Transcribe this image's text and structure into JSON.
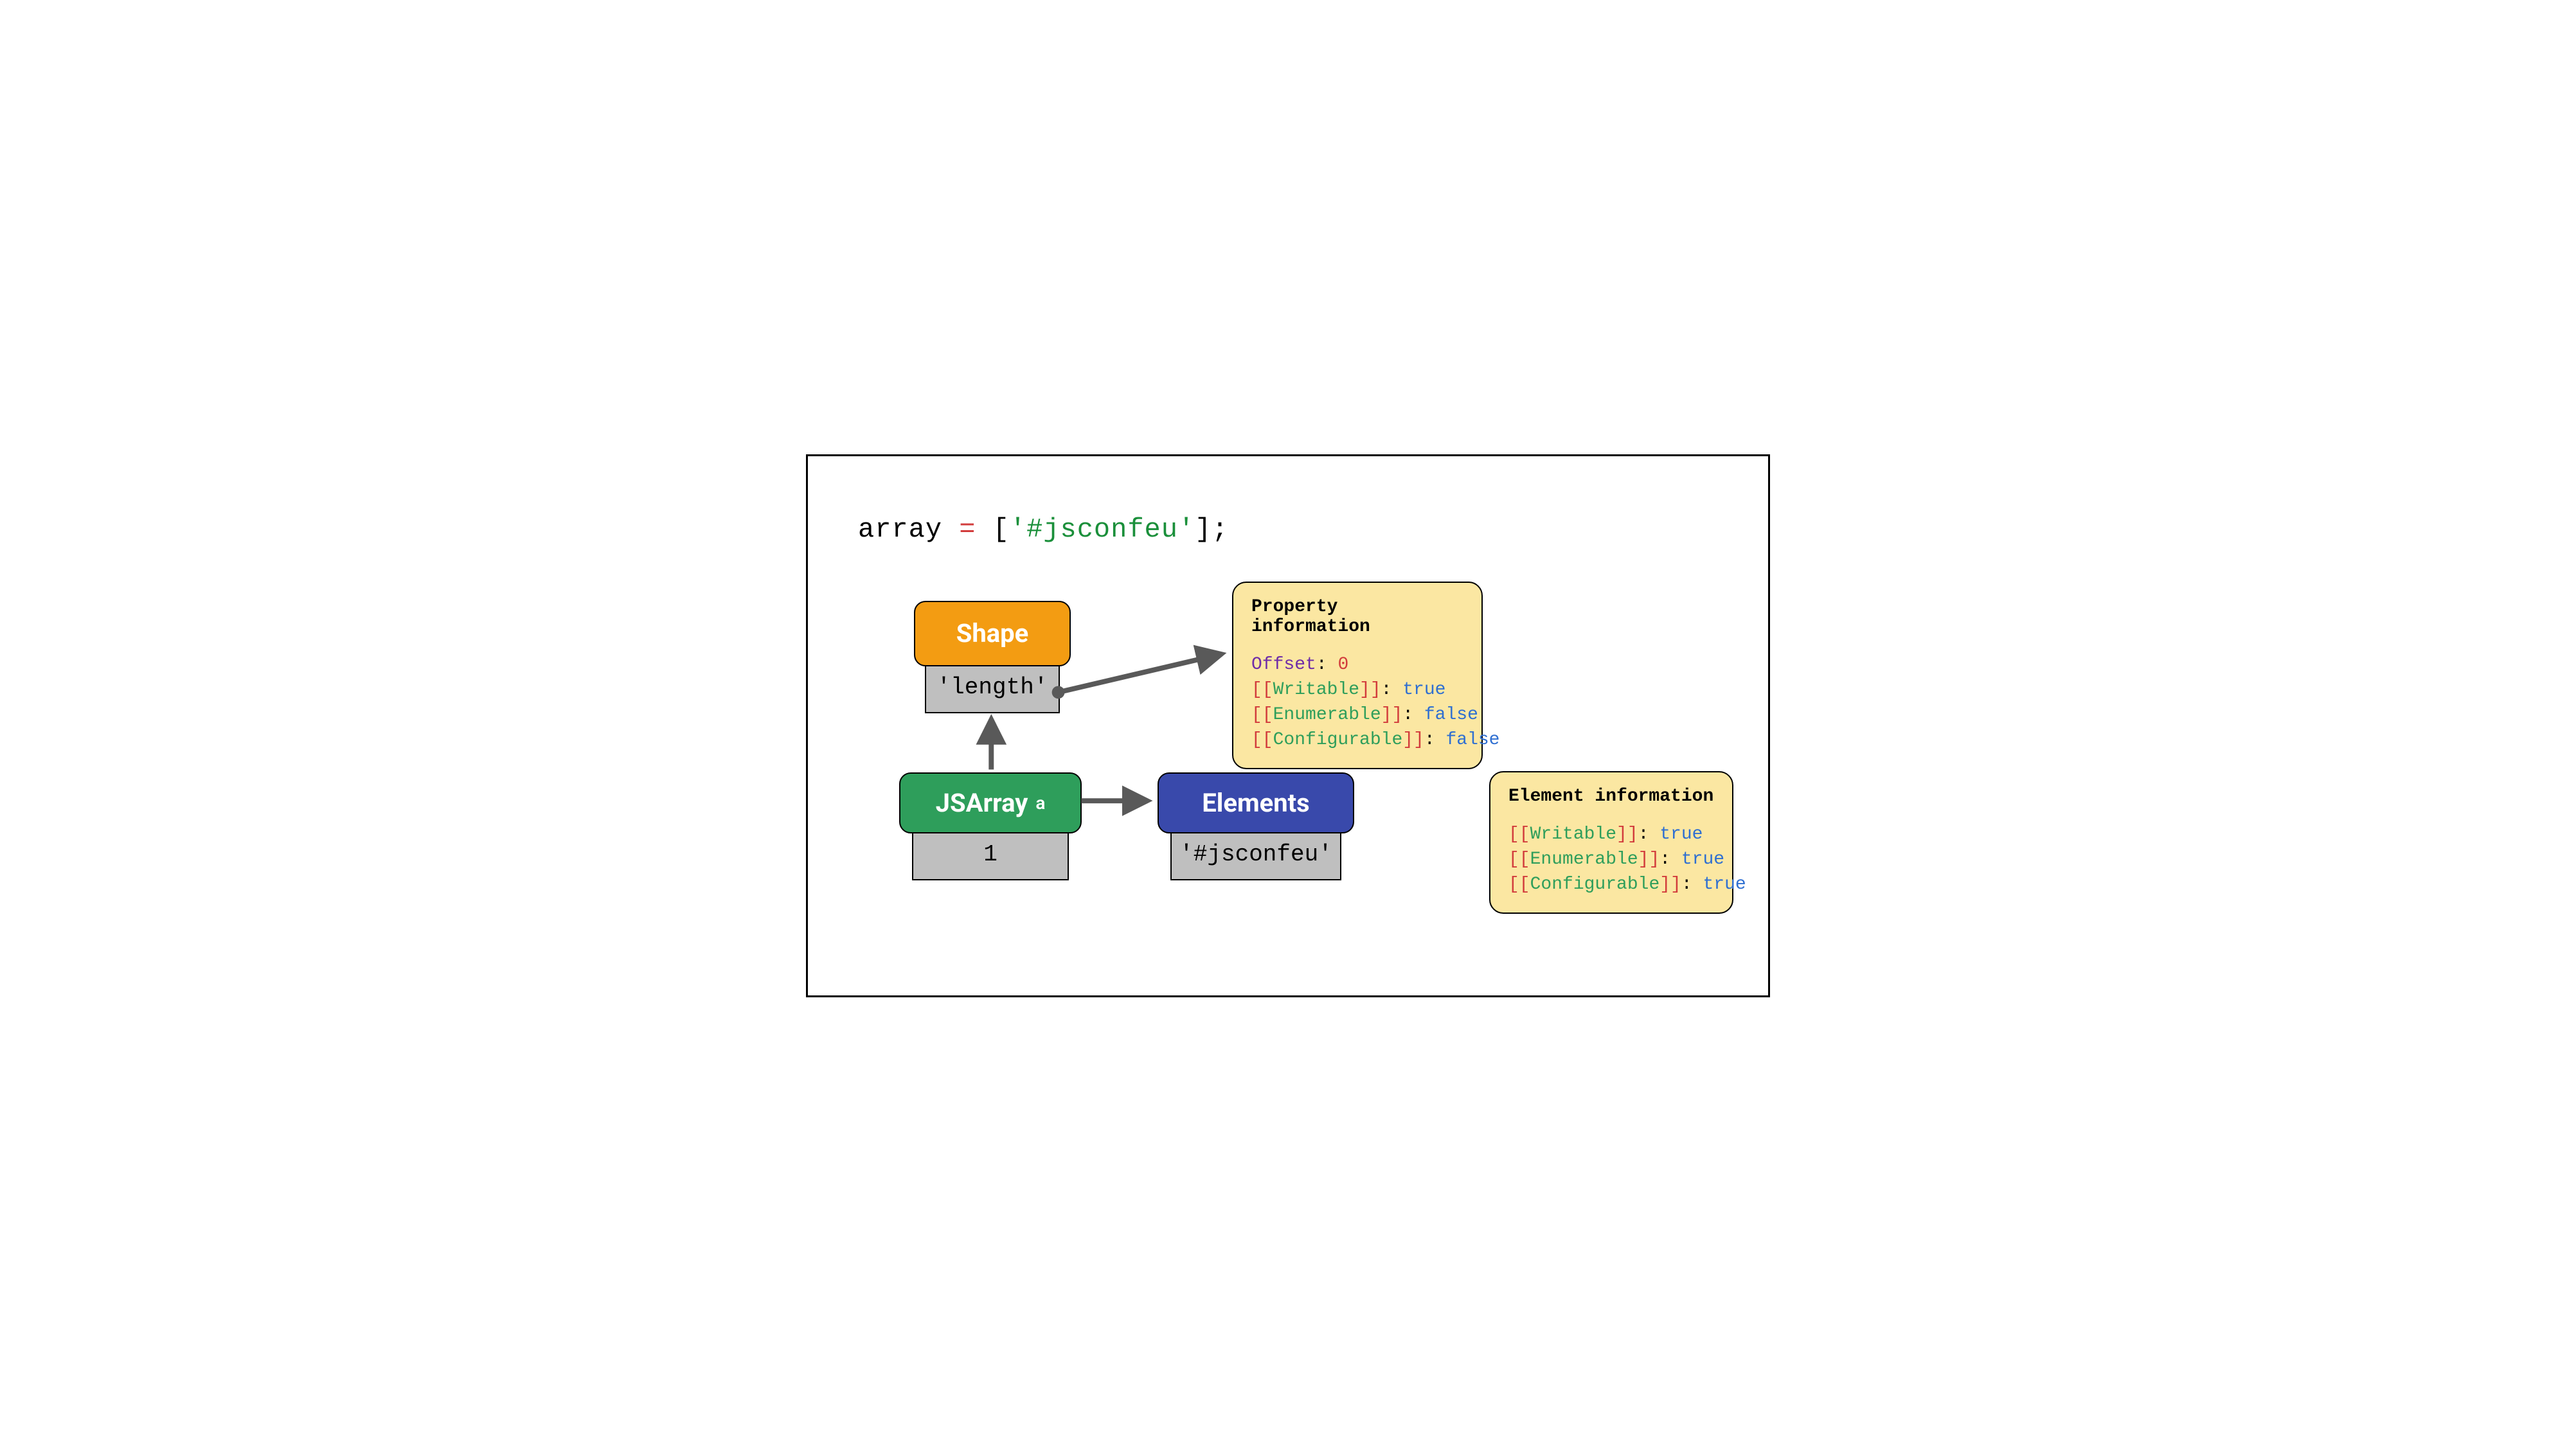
{
  "code": {
    "varname": "array",
    "equals": " = ",
    "bracket_open": "[",
    "string_open": "'",
    "string_val": "#jsconfeu",
    "string_close": "'",
    "bracket_close": "]",
    "semicolon": ";"
  },
  "shape": {
    "title": "Shape",
    "prop": "'length'"
  },
  "jsarray": {
    "title": "JSArray",
    "suffix": "a",
    "value": "1"
  },
  "elements": {
    "title": "Elements",
    "value": "'#jsconfeu'"
  },
  "propinfo": {
    "title": "Property information",
    "offset_label": "Offset",
    "offset_colon": ": ",
    "offset_val": "0",
    "writable_key": "[[Writable]]",
    "writable_colon": ": ",
    "writable_val": "true",
    "enumerable_key": "[[Enumerable]]",
    "enumerable_colon": ": ",
    "enumerable_val": "false",
    "configurable_key": "[[Configurable]]",
    "configurable_colon": ": ",
    "configurable_val": "false"
  },
  "eleminfo": {
    "title": "Element information",
    "writable_key": "[[Writable]]",
    "writable_colon": ": ",
    "writable_val": "true",
    "enumerable_key": "[[Enumerable]]",
    "enumerable_colon": ": ",
    "enumerable_val": "true",
    "configurable_key": "[[Configurable]]",
    "configurable_colon": ": ",
    "configurable_val": "true"
  }
}
